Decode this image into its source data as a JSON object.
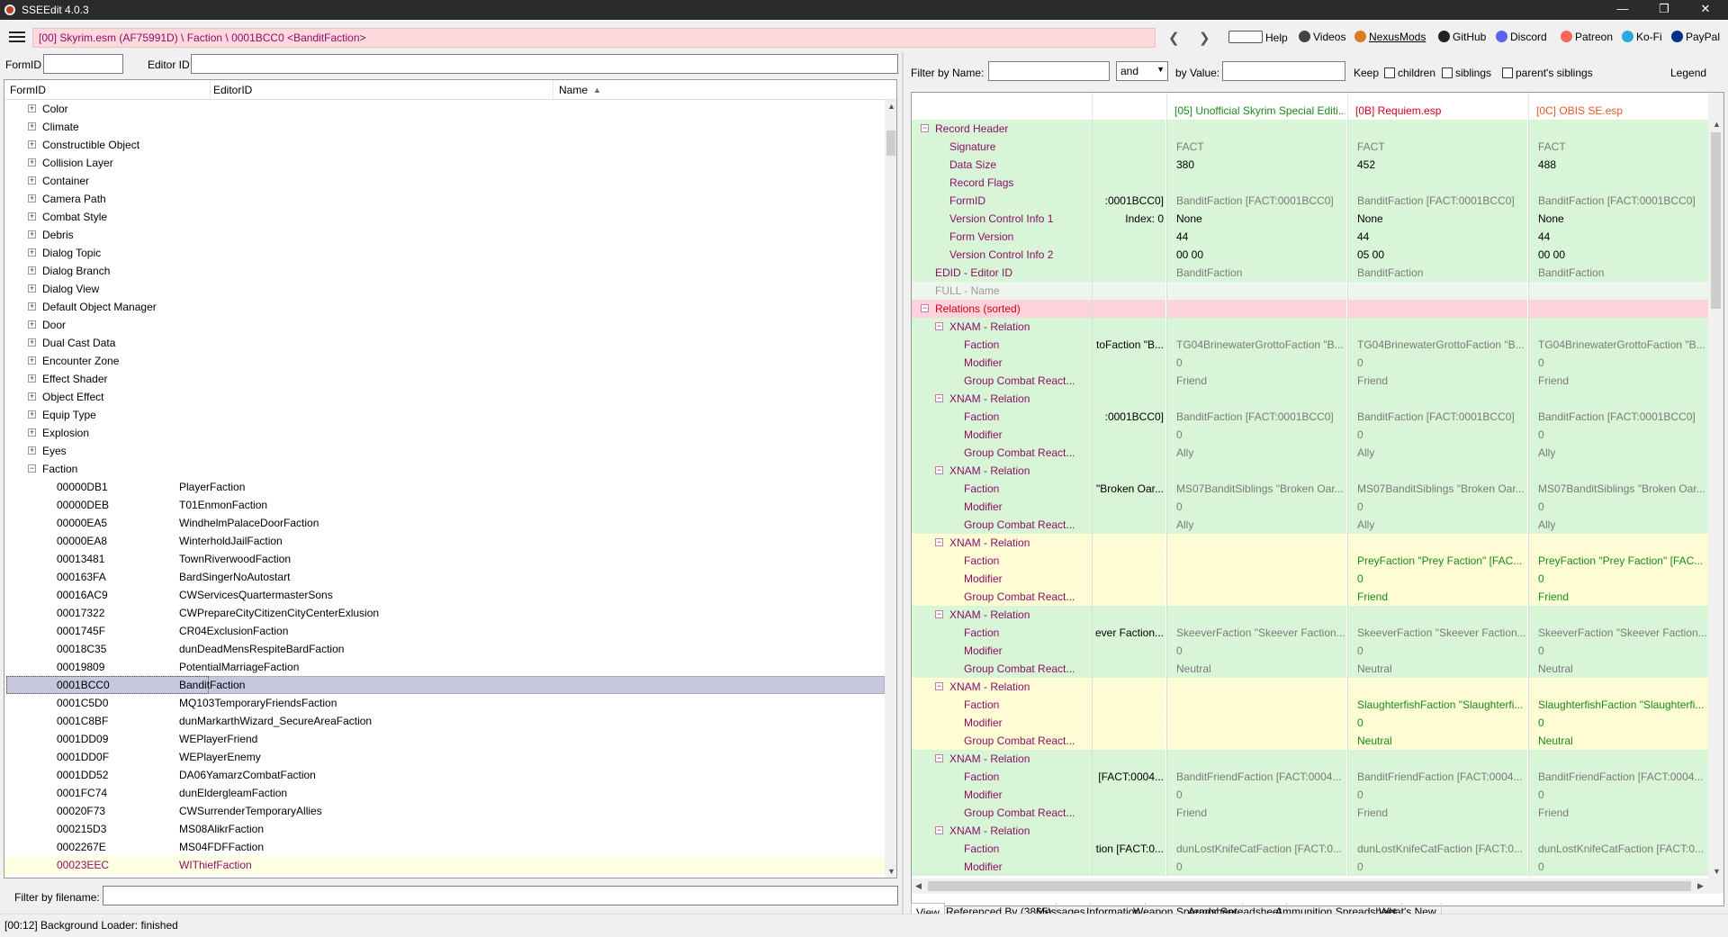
{
  "window": {
    "title": "SSEEdit 4.0.3",
    "minimize": "—",
    "maximize": "❐",
    "close": "✕"
  },
  "toolbar": {
    "breadcrumb": "[00] Skyrim.esm (AF75991D) \\ Faction \\ 0001BCC0 <BanditFaction>",
    "back": "❮",
    "forward": "❯",
    "links": {
      "help": "Help",
      "videos": "Videos",
      "nexusmods": "NexusMods",
      "github": "GitHub",
      "discord": "Discord",
      "patreon": "Patreon",
      "kofi": "Ko-Fi",
      "paypal": "PayPal"
    }
  },
  "left": {
    "formid_label": "FormID",
    "editorid_label": "Editor ID",
    "formid_value": "",
    "editorid_value": "",
    "columns": {
      "formid": "FormID",
      "editorid": "EditorID",
      "name": "Name",
      "sort_icon": "▲"
    },
    "categories": [
      "Color",
      "Climate",
      "Constructible Object",
      "Collision Layer",
      "Container",
      "Camera Path",
      "Combat Style",
      "Debris",
      "Dialog Topic",
      "Dialog Branch",
      "Dialog View",
      "Default Object Manager",
      "Door",
      "Dual Cast Data",
      "Encounter Zone",
      "Effect Shader",
      "Object Effect",
      "Equip Type",
      "Explosion",
      "Eyes"
    ],
    "faction_label": "Faction",
    "factions": [
      {
        "id": "00000DB1",
        "edid": "PlayerFaction"
      },
      {
        "id": "00000DEB",
        "edid": "T01EnmonFaction"
      },
      {
        "id": "00000EA5",
        "edid": "WindhelmPalaceDoorFaction"
      },
      {
        "id": "00000EA8",
        "edid": "WinterholdJailFaction"
      },
      {
        "id": "00013481",
        "edid": "TownRiverwoodFaction"
      },
      {
        "id": "000163FA",
        "edid": "BardSingerNoAutostart"
      },
      {
        "id": "00016AC9",
        "edid": "CWServicesQuartermasterSons"
      },
      {
        "id": "00017322",
        "edid": "CWPrepareCityCitizenCityCenterExlusion"
      },
      {
        "id": "0001745F",
        "edid": "CR04ExclusionFaction"
      },
      {
        "id": "00018C35",
        "edid": "dunDeadMensRespiteBardFaction"
      },
      {
        "id": "00019809",
        "edid": "PotentialMarriageFaction"
      },
      {
        "id": "0001BCC0",
        "edid": "BanditFaction"
      },
      {
        "id": "0001C5D0",
        "edid": "MQ103TemporaryFriendsFaction"
      },
      {
        "id": "0001C8BF",
        "edid": "dunMarkarthWizard_SecureAreaFaction"
      },
      {
        "id": "0001DD09",
        "edid": "WEPlayerFriend"
      },
      {
        "id": "0001DD0F",
        "edid": "WEPlayerEnemy"
      },
      {
        "id": "0001DD52",
        "edid": "DA06YamarzCombatFaction"
      },
      {
        "id": "0001FC74",
        "edid": "dunEldergleamFaction"
      },
      {
        "id": "00020F73",
        "edid": "CWSurrenderTemporaryAllies"
      },
      {
        "id": "000215D3",
        "edid": "MS08AlikrFaction"
      },
      {
        "id": "0002267E",
        "edid": "MS04FDFFaction"
      },
      {
        "id": "00023EEC",
        "edid": "WIThiefFaction"
      }
    ],
    "filter_filename_label": "Filter by filename:"
  },
  "right": {
    "filter_name_label": "Filter by Name:",
    "and_value": "and",
    "filter_value_label": "by Value:",
    "keep_label": "Keep",
    "children_label": "children",
    "siblings_label": "siblings",
    "parents_siblings_label": "parent's siblings",
    "legend_label": "Legend",
    "files": [
      "[05] Unofficial Skyrim Special Editi...",
      "[0B] Requiem.esp",
      "[0C] OBIS SE.esp"
    ],
    "rows": [
      {
        "label": "Record Header",
        "lvl": 0,
        "exp": "⊟",
        "bg": "green",
        "c1": "",
        "c2": "",
        "c3": "",
        "c4": ""
      },
      {
        "label": "Signature",
        "lvl": 1,
        "bg": "green",
        "c1": "",
        "c2": "FACT",
        "c3": "FACT",
        "c4": "FACT",
        "tone": "muted"
      },
      {
        "label": "Data Size",
        "lvl": 1,
        "bg": "green",
        "c1": "",
        "c2": "380",
        "c3": "452",
        "c4": "488",
        "tone": "strong"
      },
      {
        "label": "Record Flags",
        "lvl": 1,
        "bg": "green",
        "c1": "",
        "c2": "",
        "c3": "",
        "c4": ""
      },
      {
        "label": "FormID",
        "lvl": 1,
        "bg": "green",
        "c1": ":0001BCC0]",
        "c2": "BanditFaction [FACT:0001BCC0]",
        "c3": "BanditFaction [FACT:0001BCC0]",
        "c4": "BanditFaction [FACT:0001BCC0]",
        "tone": "muted"
      },
      {
        "label": "Version Control Info 1",
        "lvl": 1,
        "bg": "green",
        "c1": "Index: 0",
        "c2": "None",
        "c3": "None",
        "c4": "None",
        "tone": "strong"
      },
      {
        "label": "Form Version",
        "lvl": 1,
        "bg": "green",
        "c1": "",
        "c2": "44",
        "c3": "44",
        "c4": "44",
        "tone": "strong"
      },
      {
        "label": "Version Control Info 2",
        "lvl": 1,
        "bg": "green",
        "c1": "",
        "c2": "00 00",
        "c3": "05 00",
        "c4": "00 00",
        "tone": "strong"
      },
      {
        "label": "EDID - Editor ID",
        "lvl": 0,
        "bg": "green",
        "c1": "",
        "c2": "BanditFaction",
        "c3": "BanditFaction",
        "c4": "BanditFaction",
        "tone": "muted"
      },
      {
        "label": "FULL - Name",
        "lvl": 0,
        "bg": "grey",
        "c1": "",
        "c2": "",
        "c3": "",
        "c4": "",
        "labeltone": "muted"
      },
      {
        "label": "Relations (sorted)",
        "lvl": 0,
        "exp": "⊟",
        "bg": "pink",
        "c1": "",
        "c2": "",
        "c3": "",
        "c4": "",
        "labeltone": "red"
      },
      {
        "label": "XNAM - Relation",
        "lvl": 1,
        "exp": "⊟",
        "bg": "green",
        "c1": "",
        "c2": "",
        "c3": "",
        "c4": ""
      },
      {
        "label": "Faction",
        "lvl": 2,
        "bg": "green",
        "c1": "toFaction \"B...",
        "c2": "TG04BrinewaterGrottoFaction \"B...",
        "c3": "TG04BrinewaterGrottoFaction \"B...",
        "c4": "TG04BrinewaterGrottoFaction \"B...",
        "tone": "muted"
      },
      {
        "label": "Modifier",
        "lvl": 2,
        "bg": "green",
        "c1": "",
        "c2": "0",
        "c3": "0",
        "c4": "0",
        "tone": "muted"
      },
      {
        "label": "Group Combat React...",
        "lvl": 2,
        "bg": "green",
        "c1": "",
        "c2": "Friend",
        "c3": "Friend",
        "c4": "Friend",
        "tone": "muted"
      },
      {
        "label": "XNAM - Relation",
        "lvl": 1,
        "exp": "⊟",
        "bg": "green",
        "c1": "",
        "c2": "",
        "c3": "",
        "c4": ""
      },
      {
        "label": "Faction",
        "lvl": 2,
        "bg": "green",
        "c1": ":0001BCC0]",
        "c2": "BanditFaction [FACT:0001BCC0]",
        "c3": "BanditFaction [FACT:0001BCC0]",
        "c4": "BanditFaction [FACT:0001BCC0]",
        "tone": "muted"
      },
      {
        "label": "Modifier",
        "lvl": 2,
        "bg": "green",
        "c1": "",
        "c2": "0",
        "c3": "0",
        "c4": "0",
        "tone": "muted"
      },
      {
        "label": "Group Combat React...",
        "lvl": 2,
        "bg": "green",
        "c1": "",
        "c2": "Ally",
        "c3": "Ally",
        "c4": "Ally",
        "tone": "muted"
      },
      {
        "label": "XNAM - Relation",
        "lvl": 1,
        "exp": "⊟",
        "bg": "green",
        "c1": "",
        "c2": "",
        "c3": "",
        "c4": ""
      },
      {
        "label": "Faction",
        "lvl": 2,
        "bg": "green",
        "c1": "\"Broken Oar...",
        "c2": "MS07BanditSiblings \"Broken Oar...",
        "c3": "MS07BanditSiblings \"Broken Oar...",
        "c4": "MS07BanditSiblings \"Broken Oar...",
        "tone": "muted"
      },
      {
        "label": "Modifier",
        "lvl": 2,
        "bg": "green",
        "c1": "",
        "c2": "0",
        "c3": "0",
        "c4": "0",
        "tone": "muted"
      },
      {
        "label": "Group Combat React...",
        "lvl": 2,
        "bg": "green",
        "c1": "",
        "c2": "Ally",
        "c3": "Ally",
        "c4": "Ally",
        "tone": "muted"
      },
      {
        "label": "XNAM - Relation",
        "lvl": 1,
        "exp": "⊟",
        "bg": "yellow",
        "c1": "",
        "c2": "",
        "c3": "",
        "c4": ""
      },
      {
        "label": "Faction",
        "lvl": 2,
        "bg": "yellow",
        "c1": "",
        "c2": "",
        "c3": "PreyFaction \"Prey Faction\" [FAC...",
        "c4": "PreyFaction \"Prey Faction\" [FAC...",
        "tone": "gr"
      },
      {
        "label": "Modifier",
        "lvl": 2,
        "bg": "yellow",
        "c1": "",
        "c2": "",
        "c3": "0",
        "c4": "0",
        "tone": "gr"
      },
      {
        "label": "Group Combat React...",
        "lvl": 2,
        "bg": "yellow",
        "c1": "",
        "c2": "",
        "c3": "Friend",
        "c4": "Friend",
        "tone": "gr"
      },
      {
        "label": "XNAM - Relation",
        "lvl": 1,
        "exp": "⊟",
        "bg": "green",
        "c1": "",
        "c2": "",
        "c3": "",
        "c4": ""
      },
      {
        "label": "Faction",
        "lvl": 2,
        "bg": "green",
        "c1": "ever Faction...",
        "c2": "SkeeverFaction \"Skeever Faction...",
        "c3": "SkeeverFaction \"Skeever Faction...",
        "c4": "SkeeverFaction \"Skeever Faction...",
        "tone": "muted"
      },
      {
        "label": "Modifier",
        "lvl": 2,
        "bg": "green",
        "c1": "",
        "c2": "0",
        "c3": "0",
        "c4": "0",
        "tone": "muted"
      },
      {
        "label": "Group Combat React...",
        "lvl": 2,
        "bg": "green",
        "c1": "",
        "c2": "Neutral",
        "c3": "Neutral",
        "c4": "Neutral",
        "tone": "muted"
      },
      {
        "label": "XNAM - Relation",
        "lvl": 1,
        "exp": "⊟",
        "bg": "yellow",
        "c1": "",
        "c2": "",
        "c3": "",
        "c4": ""
      },
      {
        "label": "Faction",
        "lvl": 2,
        "bg": "yellow",
        "c1": "",
        "c2": "",
        "c3": "SlaughterfishFaction \"Slaughterfi...",
        "c4": "SlaughterfishFaction \"Slaughterfi...",
        "tone": "gr"
      },
      {
        "label": "Modifier",
        "lvl": 2,
        "bg": "yellow",
        "c1": "",
        "c2": "",
        "c3": "0",
        "c4": "0",
        "tone": "gr"
      },
      {
        "label": "Group Combat React...",
        "lvl": 2,
        "bg": "yellow",
        "c1": "",
        "c2": "",
        "c3": "Neutral",
        "c4": "Neutral",
        "tone": "gr"
      },
      {
        "label": "XNAM - Relation",
        "lvl": 1,
        "exp": "⊟",
        "bg": "green",
        "c1": "",
        "c2": "",
        "c3": "",
        "c4": ""
      },
      {
        "label": "Faction",
        "lvl": 2,
        "bg": "green",
        "c1": "[FACT:0004...",
        "c2": "BanditFriendFaction [FACT:0004...",
        "c3": "BanditFriendFaction [FACT:0004...",
        "c4": "BanditFriendFaction [FACT:0004...",
        "tone": "muted"
      },
      {
        "label": "Modifier",
        "lvl": 2,
        "bg": "green",
        "c1": "",
        "c2": "0",
        "c3": "0",
        "c4": "0",
        "tone": "muted"
      },
      {
        "label": "Group Combat React...",
        "lvl": 2,
        "bg": "green",
        "c1": "",
        "c2": "Friend",
        "c3": "Friend",
        "c4": "Friend",
        "tone": "muted"
      },
      {
        "label": "XNAM - Relation",
        "lvl": 1,
        "exp": "⊟",
        "bg": "green",
        "c1": "",
        "c2": "",
        "c3": "",
        "c4": ""
      },
      {
        "label": "Faction",
        "lvl": 2,
        "bg": "green",
        "c1": "tion [FACT:0...",
        "c2": "dunLostKnifeCatFaction [FACT:0...",
        "c3": "dunLostKnifeCatFaction [FACT:0...",
        "c4": "dunLostKnifeCatFaction [FACT:0...",
        "tone": "muted"
      },
      {
        "label": "Modifier",
        "lvl": 2,
        "bg": "green",
        "c1": "",
        "c2": "0",
        "c3": "0",
        "c4": "0",
        "tone": "muted"
      }
    ],
    "tabs": [
      "View",
      "Referenced By (3865)",
      "Messages",
      "Information",
      "Weapon Spreadsheet",
      "Armor Spreadsheet",
      "Ammunition Spreadsheet",
      "What's New"
    ]
  },
  "status": "[00:12] Background Loader: finished",
  "colors": {
    "accent": "#8b0f67",
    "breadcrumb_bg": "#fdd8dc",
    "green": "#d8f5d8",
    "yellow": "#fdfcd5",
    "pink": "#ffd3dc",
    "selection": "#c7c7dd"
  }
}
